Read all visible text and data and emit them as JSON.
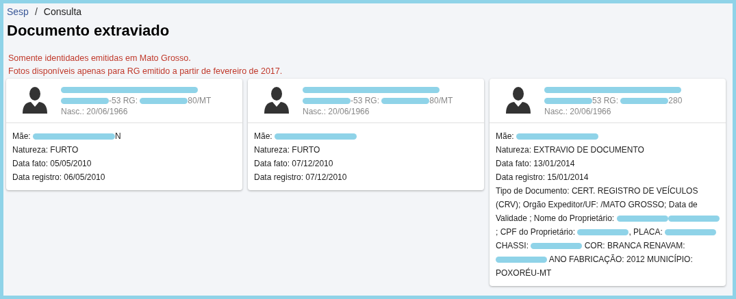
{
  "breadcrumb": [
    {
      "label": "Sesp",
      "kind": "link"
    },
    {
      "label": "Consulta",
      "kind": "current"
    }
  ],
  "breadcrumb_separator": "/",
  "title": "Documento extraviado",
  "warnings": [
    "Somente identidades emitidas em Mato Grosso.",
    "Fotos disponíveis apenas para RG emitido a partir de fevereiro de 2017."
  ],
  "cards": [
    {
      "name": [
        {
          "kind": "redaction"
        }
      ],
      "id_line": [
        {
          "kind": "redaction"
        },
        {
          "kind": "text",
          "text": "-53  RG: "
        },
        {
          "kind": "redaction"
        },
        {
          "kind": "text",
          "text": "80/MT"
        }
      ],
      "birth": "Nasc.: 20/06/1966",
      "details": [
        [
          {
            "kind": "text",
            "text": "Mãe: "
          },
          {
            "kind": "redaction"
          },
          {
            "kind": "text",
            "text": "N"
          }
        ],
        [
          {
            "kind": "text",
            "text": "Natureza: FURTO"
          }
        ],
        [
          {
            "kind": "text",
            "text": "Data fato: 05/05/2010"
          }
        ],
        [
          {
            "kind": "text",
            "text": "Data registro: 06/05/2010"
          }
        ]
      ]
    },
    {
      "name": [
        {
          "kind": "redaction"
        }
      ],
      "id_line": [
        {
          "kind": "redaction"
        },
        {
          "kind": "text",
          "text": "-53  RG: "
        },
        {
          "kind": "redaction"
        },
        {
          "kind": "text",
          "text": "80/MT"
        }
      ],
      "birth": "Nasc.: 20/06/1966",
      "details": [
        [
          {
            "kind": "text",
            "text": "Mãe: "
          },
          {
            "kind": "redaction"
          }
        ],
        [
          {
            "kind": "text",
            "text": "Natureza: FURTO"
          }
        ],
        [
          {
            "kind": "text",
            "text": "Data fato: 07/12/2010"
          }
        ],
        [
          {
            "kind": "text",
            "text": "Data registro: 07/12/2010"
          }
        ]
      ]
    },
    {
      "name": [
        {
          "kind": "redaction"
        }
      ],
      "id_line": [
        {
          "kind": "redaction"
        },
        {
          "kind": "text",
          "text": "53  RG: "
        },
        {
          "kind": "redaction"
        },
        {
          "kind": "text",
          "text": "280"
        }
      ],
      "birth": "Nasc.: 20/06/1966",
      "details": [
        [
          {
            "kind": "text",
            "text": "Mãe: "
          },
          {
            "kind": "redaction"
          }
        ],
        [
          {
            "kind": "text",
            "text": "Natureza: EXTRAVIO DE DOCUMENTO"
          }
        ],
        [
          {
            "kind": "text",
            "text": "Data fato: 13/01/2014"
          }
        ],
        [
          {
            "kind": "text",
            "text": "Data registro: 15/01/2014"
          }
        ],
        [
          {
            "kind": "text",
            "text": "Tipo de Documento: CERT. REGISTRO DE VEÍCULOS (CRV); Orgão Expeditor/UF: /MATO GROSSO; Data de Validade ; Nome do Proprietário: "
          },
          {
            "kind": "redaction"
          },
          {
            "kind": "redaction"
          },
          {
            "kind": "text",
            "text": "; CPF do Proprietário: "
          },
          {
            "kind": "redaction"
          },
          {
            "kind": "text",
            "text": ", PLACA: "
          },
          {
            "kind": "redaction"
          },
          {
            "kind": "text",
            "text": " CHASSI: "
          },
          {
            "kind": "redaction"
          },
          {
            "kind": "text",
            "text": " COR: BRANCA RENAVAM: "
          },
          {
            "kind": "redaction"
          },
          {
            "kind": "text",
            "text": " ANO FABRICAÇÃO: 2012 MUNICÍPIO: POXORÉU-MT"
          }
        ]
      ]
    }
  ]
}
